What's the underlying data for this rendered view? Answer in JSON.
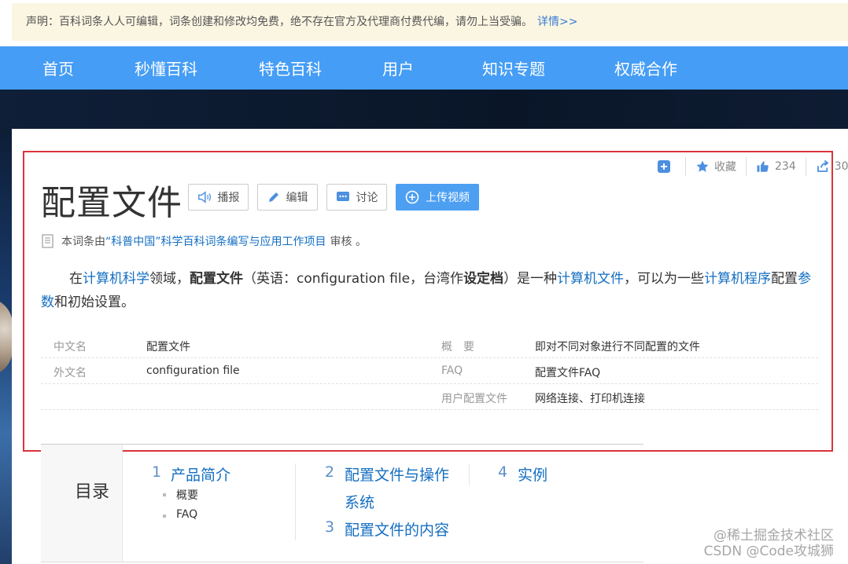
{
  "notice": {
    "text": "声明：百科词条人人可编辑，词条创建和修改均免费，绝不存在官方及代理商付费代编，请勿上当受骗。",
    "link": "详情>>"
  },
  "nav": [
    "首页",
    "秒懂百科",
    "特色百科",
    "用户",
    "知识专题",
    "权威合作"
  ],
  "actions": {
    "collect_label": "收藏",
    "like_count": "234",
    "share_count": "30"
  },
  "article": {
    "title": "配置文件",
    "buttons": {
      "broadcast": "播报",
      "edit": "编辑",
      "discuss": "讨论",
      "upload_video": "上传视频"
    },
    "review": {
      "prefix": "本词条由",
      "link": "“科普中国”科学百科词条编写与应用工作项目",
      "suffix": "审核 。"
    },
    "intro": {
      "p1": "在",
      "l1": "计算机科学",
      "p2": "领域，",
      "b1": "配置文件",
      "p3": "（英语：configuration file，台湾作",
      "b2": "设定档",
      "p4": "）是一种",
      "l2": "计算机文件",
      "p5": "，可以为一些",
      "l3": "计算机程序",
      "p6": "配置",
      "l4": "参数",
      "p7": "和初始设置。"
    }
  },
  "infobox": [
    {
      "k1": "中文名",
      "v1": "配置文件",
      "k2": "概　要",
      "v2": "即对不同对象进行不同配置的文件"
    },
    {
      "k1": "外文名",
      "v1": "configuration file",
      "k2": "FAQ",
      "v2": "配置文件FAQ"
    },
    {
      "k1": "",
      "v1": "",
      "k2": "用户配置文件",
      "v2": "网络连接、打印机连接"
    }
  ],
  "toc": {
    "label": "目录",
    "items": [
      {
        "num": "1",
        "title": "产品简介",
        "subs": [
          "概要",
          "FAQ"
        ]
      },
      {
        "num": "2",
        "title_l1": "配置文件与操作",
        "title_l2": "系统"
      },
      {
        "num": "3",
        "title": "配置文件的内容"
      },
      {
        "num": "4",
        "title": "实例"
      }
    ]
  },
  "watermark": {
    "line1": "@稀土掘金技术社区",
    "line2": "CSDN @Code攻城狮"
  },
  "colors": {
    "nav_bg": "#459df5",
    "link": "#136ec2",
    "highlight_border": "#d9343a",
    "upload_button": "#4d9ff2"
  }
}
